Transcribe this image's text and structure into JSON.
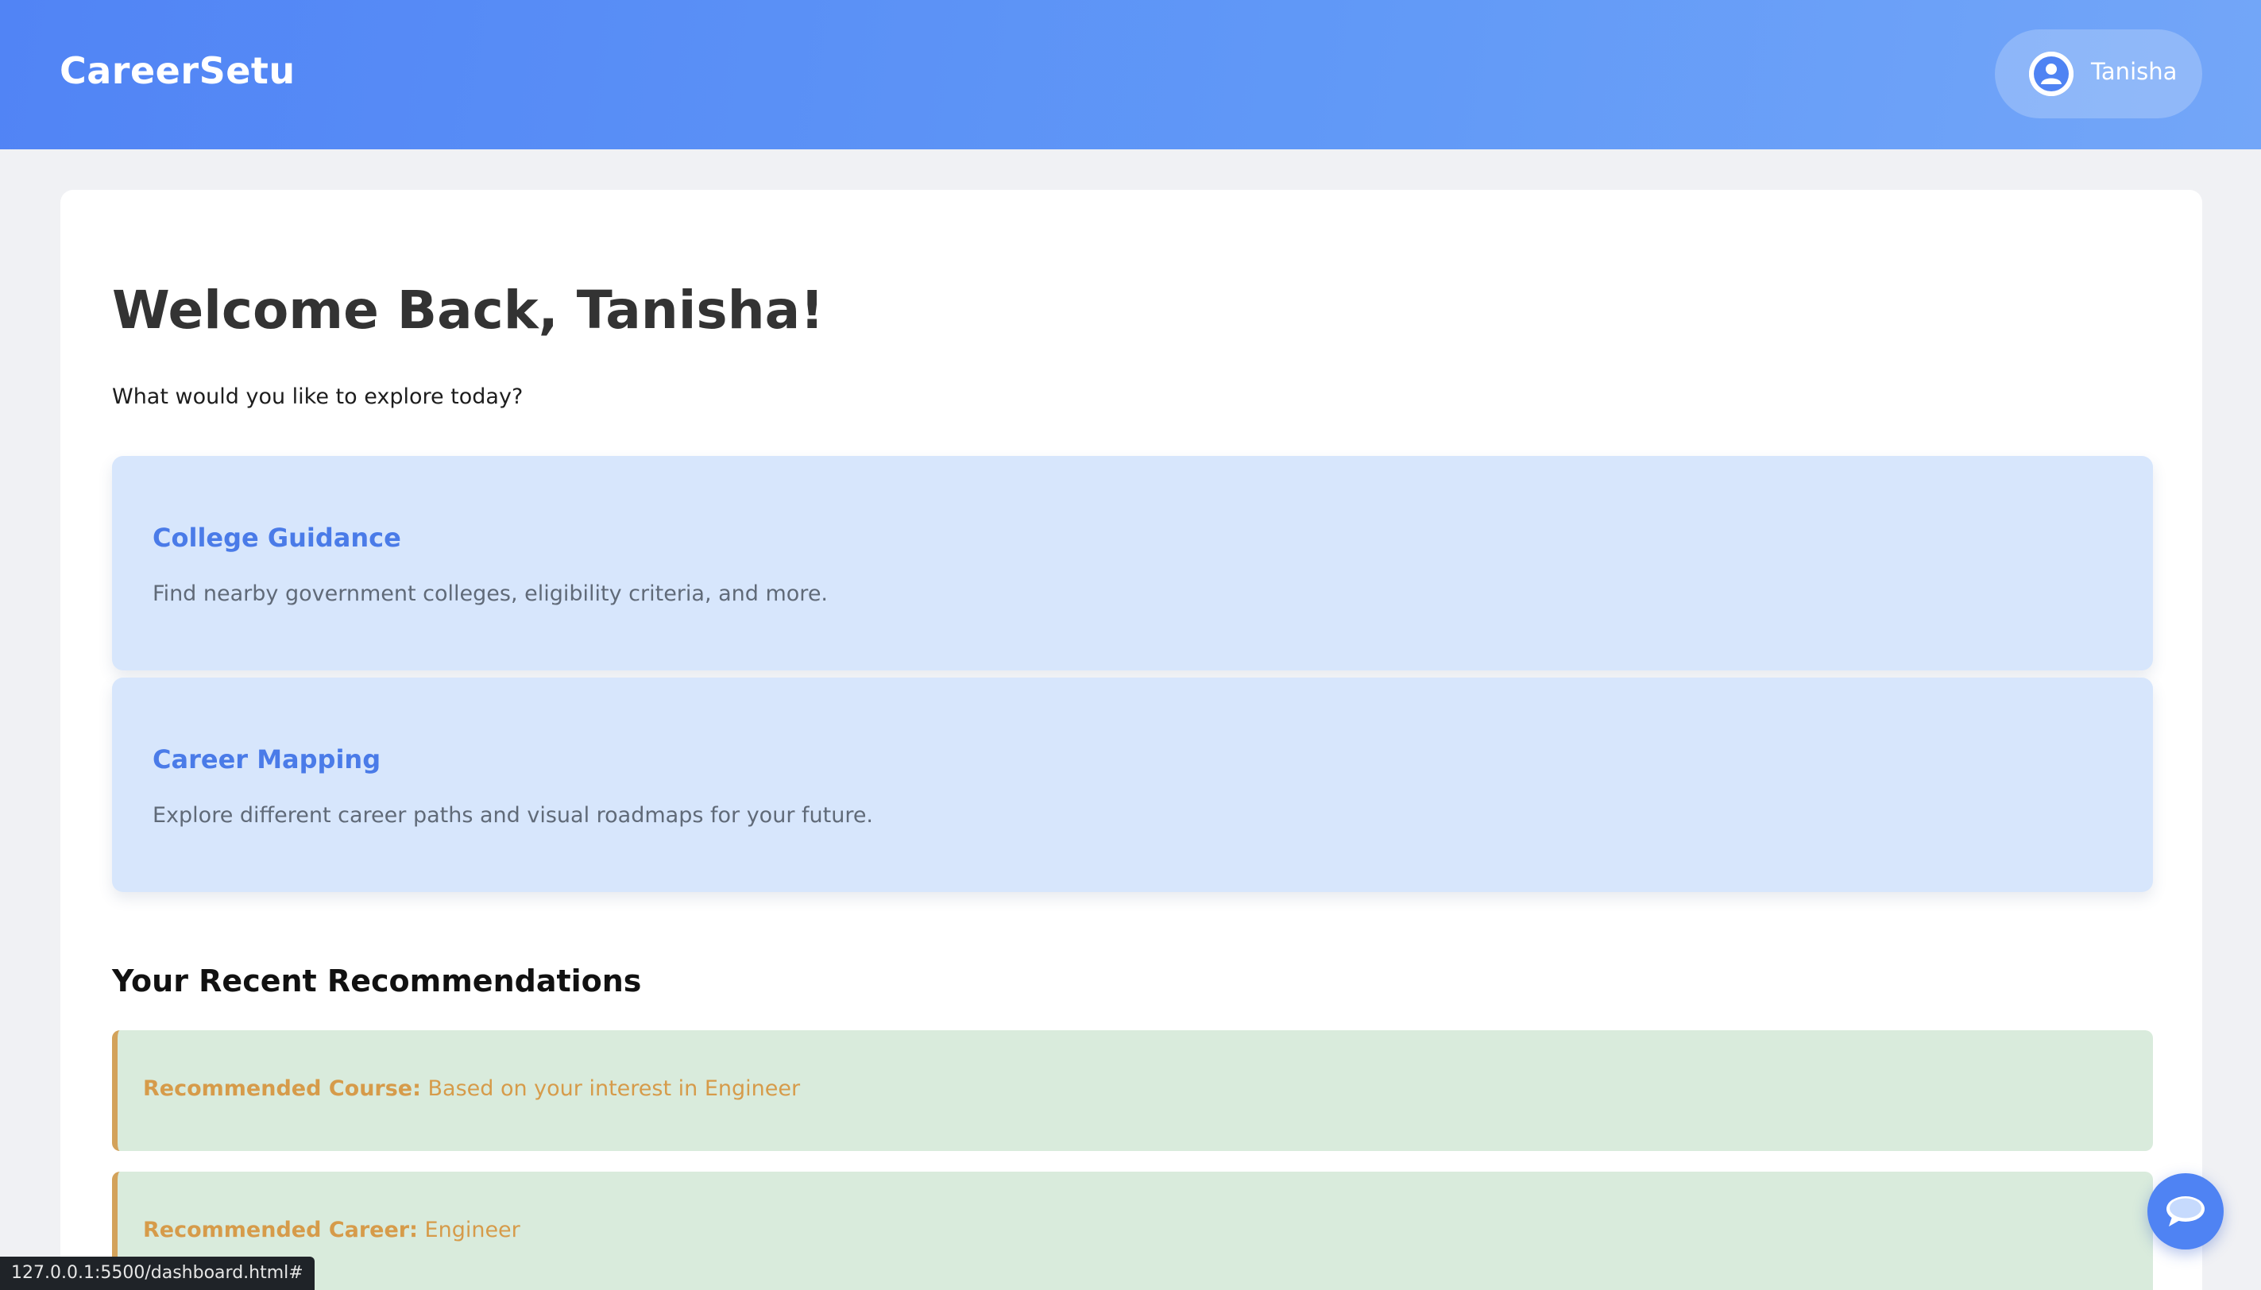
{
  "header": {
    "brand": "CareerSetu",
    "user_name": "Tanisha",
    "user_icon": "user-avatar-icon",
    "gradient": [
      "#5184f5",
      "#73a6f8"
    ]
  },
  "main": {
    "welcome": "Welcome Back, Tanisha!",
    "subtitle": "What would you like to explore today?",
    "features": [
      {
        "title": "College Guidance",
        "description": "Find nearby government colleges, eligibility criteria, and more."
      },
      {
        "title": "Career Mapping",
        "description": "Explore different career paths and visual roadmaps for your future."
      }
    ],
    "recommendations_title": "Your Recent Recommendations",
    "recommendations": [
      {
        "label": "Recommended Course:",
        "value": "Based on your interest in Engineer"
      },
      {
        "label": "Recommended Career:",
        "value": "Engineer"
      }
    ]
  },
  "status_bar": {
    "url": "127.0.0.1:5500/dashboard.html#"
  },
  "chat": {
    "icon": "chat-bubble-icon"
  },
  "colors": {
    "accent": "#4a7be8",
    "feature_bg": "#d7e6fc",
    "rec_bg": "#d9ebdc",
    "rec_accent": "#d3a25a",
    "page_bg": "#f0f1f4"
  }
}
